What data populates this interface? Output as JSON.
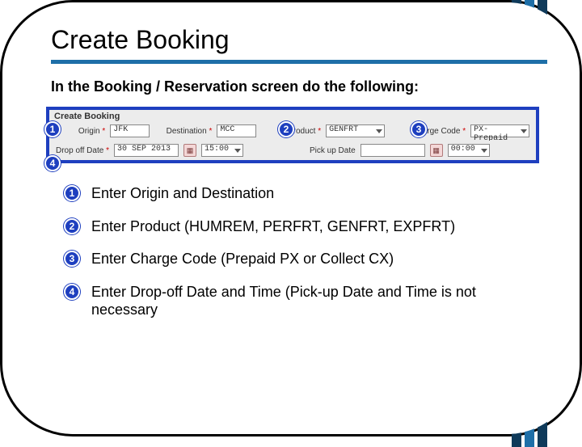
{
  "title": "Create Booking",
  "intro": "In the Booking / Reservation screen do the following:",
  "screenshot": {
    "header": "Create Booking",
    "row1": {
      "origin_label": "Origin",
      "origin_value": "JFK",
      "dest_label": "Destination",
      "dest_value": "MCC",
      "product_label": "Product",
      "product_value": "GENFRT",
      "charge_label": "Charge Code",
      "charge_value": "PX-Prepaid"
    },
    "row2": {
      "dropoff_label": "Drop off Date",
      "dropoff_value": "30 SEP 2013",
      "dropoff_time": "15:00",
      "pickup_label": "Pick up Date",
      "pickup_value": "",
      "pickup_time": "00:00"
    }
  },
  "callouts": {
    "c1": "1",
    "c2": "2",
    "c3": "3",
    "c4": "4"
  },
  "steps": [
    {
      "n": "1",
      "text": "Enter Origin and Destination"
    },
    {
      "n": "2",
      "text": "Enter Product (HUMREM, PERFRT, GENFRT, EXPFRT)"
    },
    {
      "n": "3",
      "text": "Enter Charge Code (Prepaid PX or Collect CX)"
    },
    {
      "n": "4",
      "text": "Enter Drop-off Date and Time (Pick-up Date and Time is not necessary"
    }
  ]
}
